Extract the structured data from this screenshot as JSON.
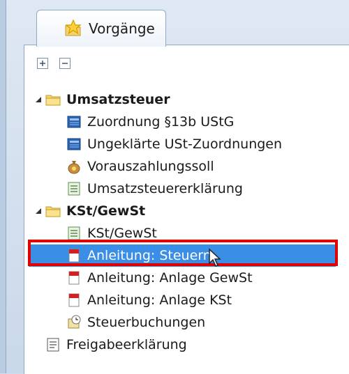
{
  "tab": {
    "label": "Vorgänge",
    "icon": "star-folder-icon"
  },
  "toolbar": {
    "expand_icon": "expand-all-icon",
    "collapse_icon": "collapse-all-icon"
  },
  "tree": {
    "groups": [
      {
        "label": "Umsatzsteuer",
        "icon": "folder-icon",
        "items": [
          {
            "label": "Zuordnung §13b UStG",
            "icon": "ledger-icon"
          },
          {
            "label": "Ungeklärte USt-Zuordnungen",
            "icon": "ledger-icon"
          },
          {
            "label": "Vorauszahlungssoll",
            "icon": "money-bag-icon"
          },
          {
            "label": "Umsatzsteuererklärung",
            "icon": "form-icon"
          }
        ]
      },
      {
        "label": "KSt/GewSt",
        "icon": "folder-icon",
        "items": [
          {
            "label": "KSt/GewSt",
            "icon": "form-icon"
          },
          {
            "label": "Anleitung: Steuern",
            "icon": "pdf-icon",
            "selected": true
          },
          {
            "label": "Anleitung: Anlage GewSt",
            "icon": "pdf-icon"
          },
          {
            "label": "Anleitung: Anlage KSt",
            "icon": "pdf-icon"
          },
          {
            "label": "Steuerbuchungen",
            "icon": "clock-doc-icon"
          }
        ]
      }
    ],
    "root_item": {
      "label": "Freigabeerklärung",
      "icon": "doc-icon"
    }
  },
  "colors": {
    "selection": "#3a8ee6",
    "highlight": "#e00000"
  }
}
